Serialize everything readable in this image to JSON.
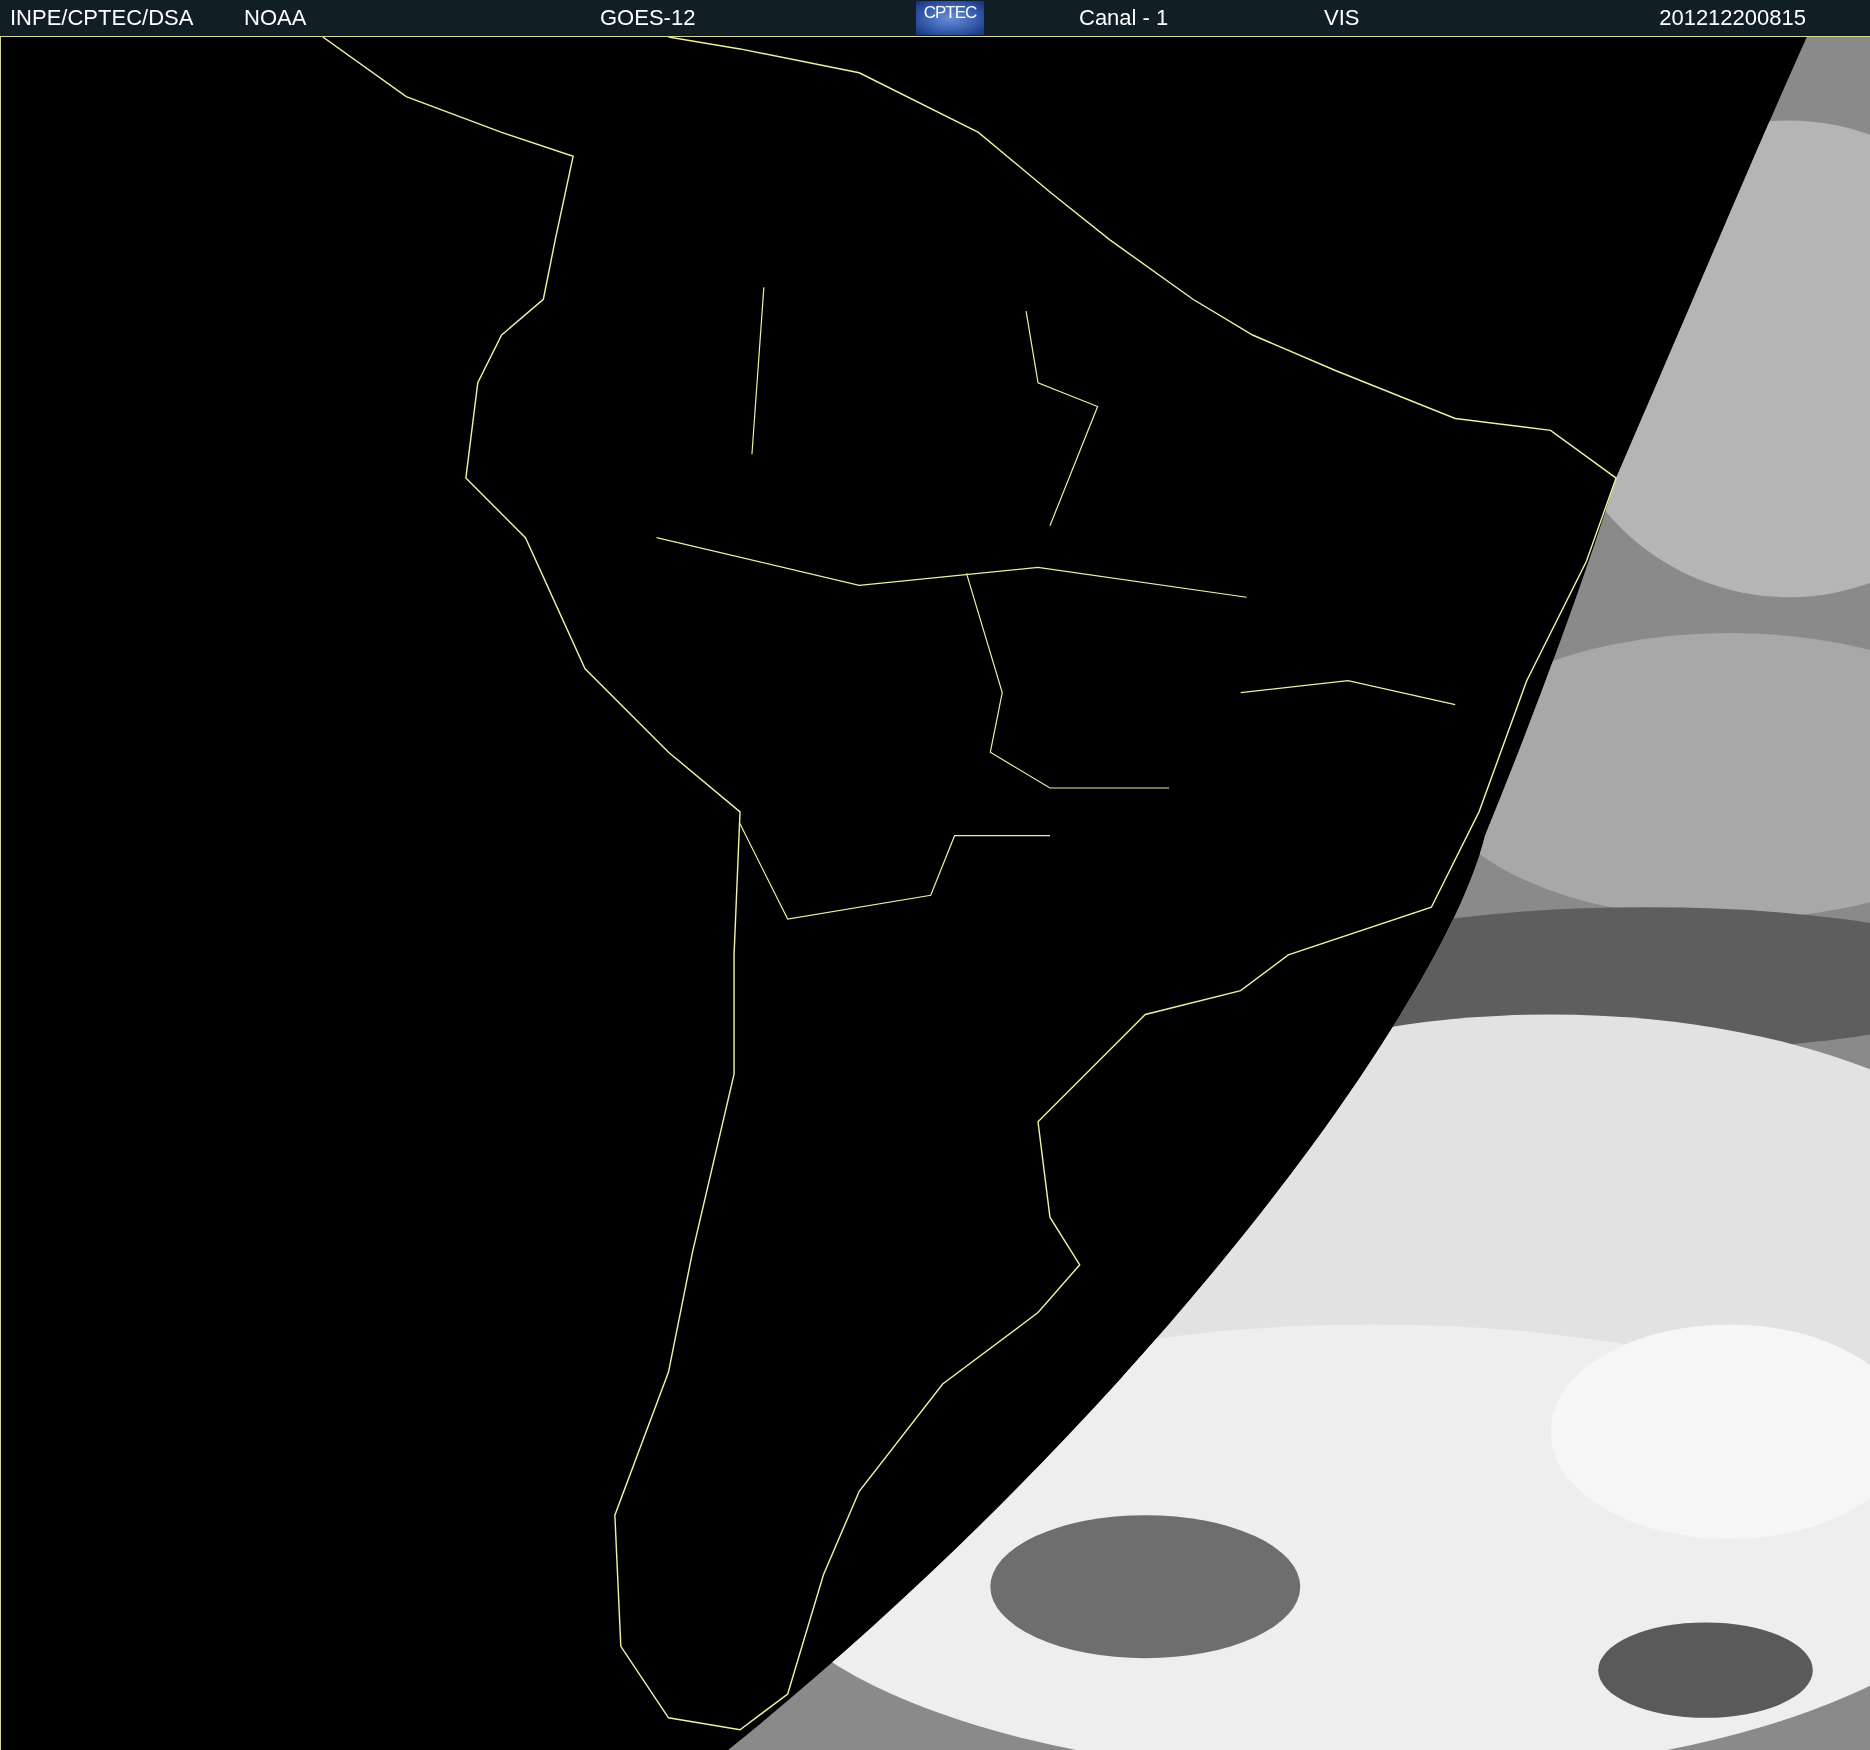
{
  "header": {
    "items": [
      {
        "kind": "text",
        "text": "INPE/CPTEC/DSA"
      },
      {
        "kind": "text",
        "text": "NOAA"
      },
      {
        "kind": "text",
        "text": "GOES-12"
      },
      {
        "kind": "logo",
        "text": "CPTEC"
      },
      {
        "kind": "text",
        "text": "Canal - 1"
      },
      {
        "kind": "text",
        "text": "VIS"
      },
      {
        "kind": "text",
        "text": "201212200815"
      }
    ]
  }
}
